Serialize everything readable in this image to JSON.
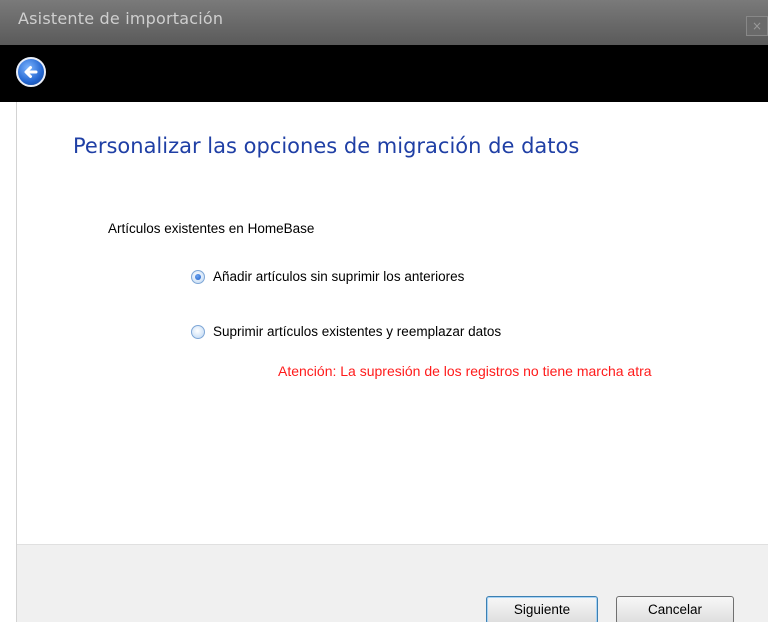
{
  "window": {
    "title": "Asistente de importación",
    "close_label": "×"
  },
  "nav": {
    "back_icon": "back-arrow-icon"
  },
  "page": {
    "heading": "Personalizar las opciones de migración de datos",
    "section_label": "Artículos existentes en HomeBase",
    "options": [
      {
        "label": "Añadir artículos sin suprimir los anteriores",
        "checked": true
      },
      {
        "label": "Suprimir artículos existentes y reemplazar datos",
        "checked": false
      }
    ],
    "warning": "Atención: La supresión de los registros no tiene marcha atra"
  },
  "footer": {
    "next_label": "Siguiente",
    "cancel_label": "Cancelar"
  },
  "colors": {
    "heading": "#1f3fa5",
    "warning": "#ff1b1b",
    "navbar": "#000000"
  }
}
